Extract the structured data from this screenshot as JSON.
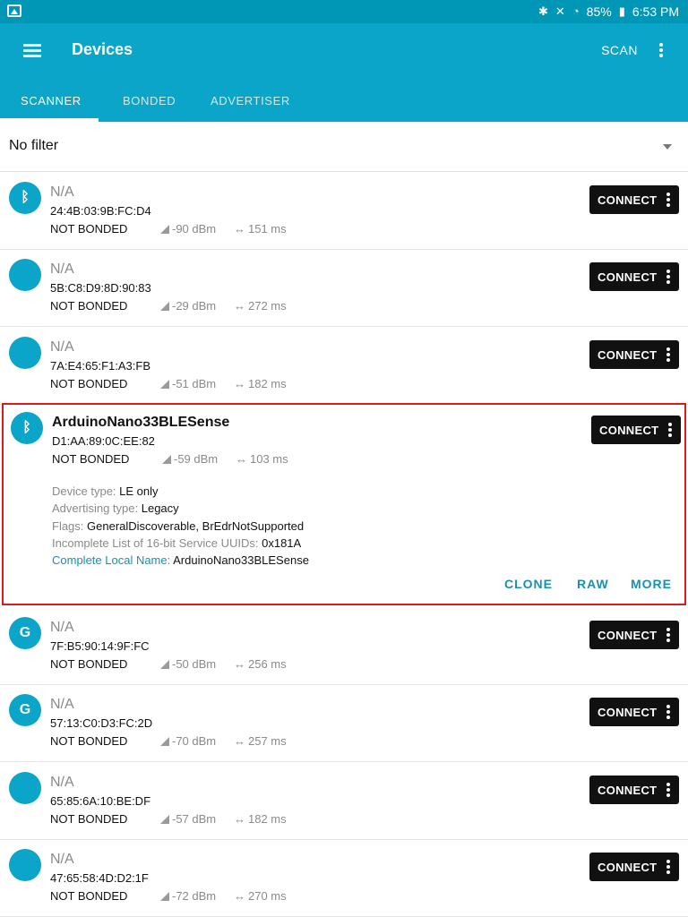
{
  "status_bar": {
    "battery": "85%",
    "time": "6:53 PM"
  },
  "app_bar": {
    "title": "Devices",
    "scan_label": "SCAN"
  },
  "tabs": [
    {
      "label": "SCANNER",
      "active": true
    },
    {
      "label": "BONDED",
      "active": false
    },
    {
      "label": "ADVERTISER",
      "active": false
    }
  ],
  "filter": {
    "label": "No filter"
  },
  "connect_label": "CONNECT",
  "devices": [
    {
      "icon": "bluetooth-icon",
      "name": "N/A",
      "address": "24:4B:03:9B:FC:D4",
      "bond": "NOT BONDED",
      "rssi": "-90 dBm",
      "interval": "151 ms"
    },
    {
      "icon": "apple-icon",
      "name": "N/A",
      "address": "5B:C8:D9:8D:90:83",
      "bond": "NOT BONDED",
      "rssi": "-29 dBm",
      "interval": "272 ms"
    },
    {
      "icon": "apple-icon",
      "name": "N/A",
      "address": "7A:E4:65:F1:A3:FB",
      "bond": "NOT BONDED",
      "rssi": "-51 dBm",
      "interval": "182 ms"
    },
    {
      "icon": "bluetooth-icon",
      "name": "ArduinoNano33BLESense",
      "address": "D1:AA:89:0C:EE:82",
      "bond": "NOT BONDED",
      "rssi": "-59 dBm",
      "interval": "103 ms",
      "details": [
        {
          "key": "Device type:",
          "value": "LE only"
        },
        {
          "key": "Advertising type:",
          "value": "Legacy"
        },
        {
          "key": "Flags:",
          "value": "GeneralDiscoverable, BrEdrNotSupported"
        },
        {
          "key": "Incomplete List of 16-bit Service UUIDs:",
          "value": "0x181A"
        },
        {
          "key": "Complete Local Name:",
          "value": "ArduinoNano33BLESense"
        }
      ],
      "actions": [
        "CLONE",
        "RAW",
        "MORE"
      ]
    },
    {
      "icon": "google-icon",
      "name": "N/A",
      "address": "7F:B5:90:14:9F:FC",
      "bond": "NOT BONDED",
      "rssi": "-50 dBm",
      "interval": "256 ms"
    },
    {
      "icon": "google-icon",
      "name": "N/A",
      "address": "57:13:C0:D3:FC:2D",
      "bond": "NOT BONDED",
      "rssi": "-70 dBm",
      "interval": "257 ms"
    },
    {
      "icon": "apple-icon",
      "name": "N/A",
      "address": "65:85:6A:10:BE:DF",
      "bond": "NOT BONDED",
      "rssi": "-57 dBm",
      "interval": "182 ms"
    },
    {
      "icon": "apple-icon",
      "name": "N/A",
      "address": "47:65:58:4D:D2:1F",
      "bond": "NOT BONDED",
      "rssi": "-72 dBm",
      "interval": "270 ms"
    }
  ]
}
